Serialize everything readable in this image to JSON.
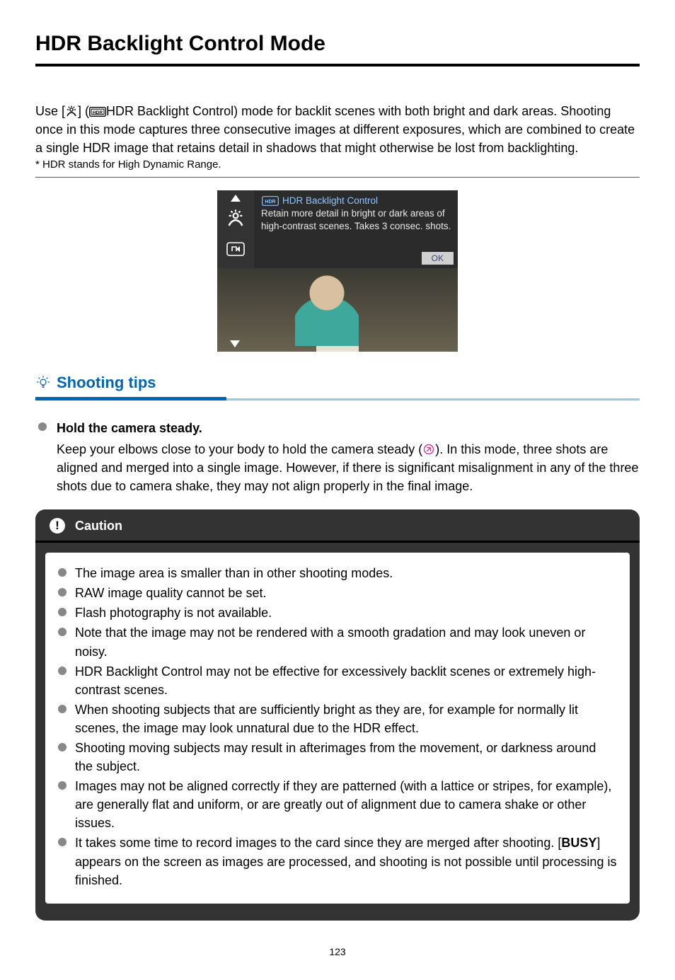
{
  "page": {
    "title": "HDR Backlight Control Mode",
    "number": "123"
  },
  "intro": {
    "prefix": "Use [",
    "middle": "] (",
    "text_after_icons": "HDR Backlight Control) mode for backlit scenes with both bright and dark areas. Shooting once in this mode captures three consecutive images at different exposures, which are combined to create a single HDR image that retains detail in shadows that might otherwise be lost from backlighting.",
    "footnote": "* HDR stands for High Dynamic Range."
  },
  "lcd": {
    "title": "HDR Backlight Control",
    "desc": "Retain more detail in bright or dark areas of high-contrast scenes. Takes 3 consec. shots.",
    "ok": "OK"
  },
  "tips": {
    "heading": "Shooting tips",
    "items": [
      {
        "title": "Hold the camera steady.",
        "body_before_link": "Keep your elbows close to your body to hold the camera steady (",
        "body_after_link": "). In this mode, three shots are aligned and merged into a single image. However, if there is significant misalignment in any of the three shots due to camera shake, they may not align properly in the final image."
      }
    ]
  },
  "caution": {
    "heading": "Caution",
    "items": [
      "The image area is smaller than in other shooting modes.",
      "RAW image quality cannot be set.",
      "Flash photography is not available.",
      "Note that the image may not be rendered with a smooth gradation and may look uneven or noisy.",
      "HDR Backlight Control may not be effective for excessively backlit scenes or extremely high-contrast scenes.",
      "When shooting subjects that are sufficiently bright as they are, for example for normally lit scenes, the image may look unnatural due to the HDR effect.",
      "Shooting moving subjects may result in afterimages from the movement, or darkness around the subject.",
      "Images may not be aligned correctly if they are patterned (with a lattice or stripes, for example), are generally flat and uniform, or are greatly out of alignment due to camera shake or other issues."
    ],
    "last_item": {
      "before": "It takes some time to record images to the card since they are merged after shooting. [",
      "bold": "BUSY",
      "after": "] appears on the screen as images are processed, and shooting is not possible until processing is finished."
    }
  }
}
